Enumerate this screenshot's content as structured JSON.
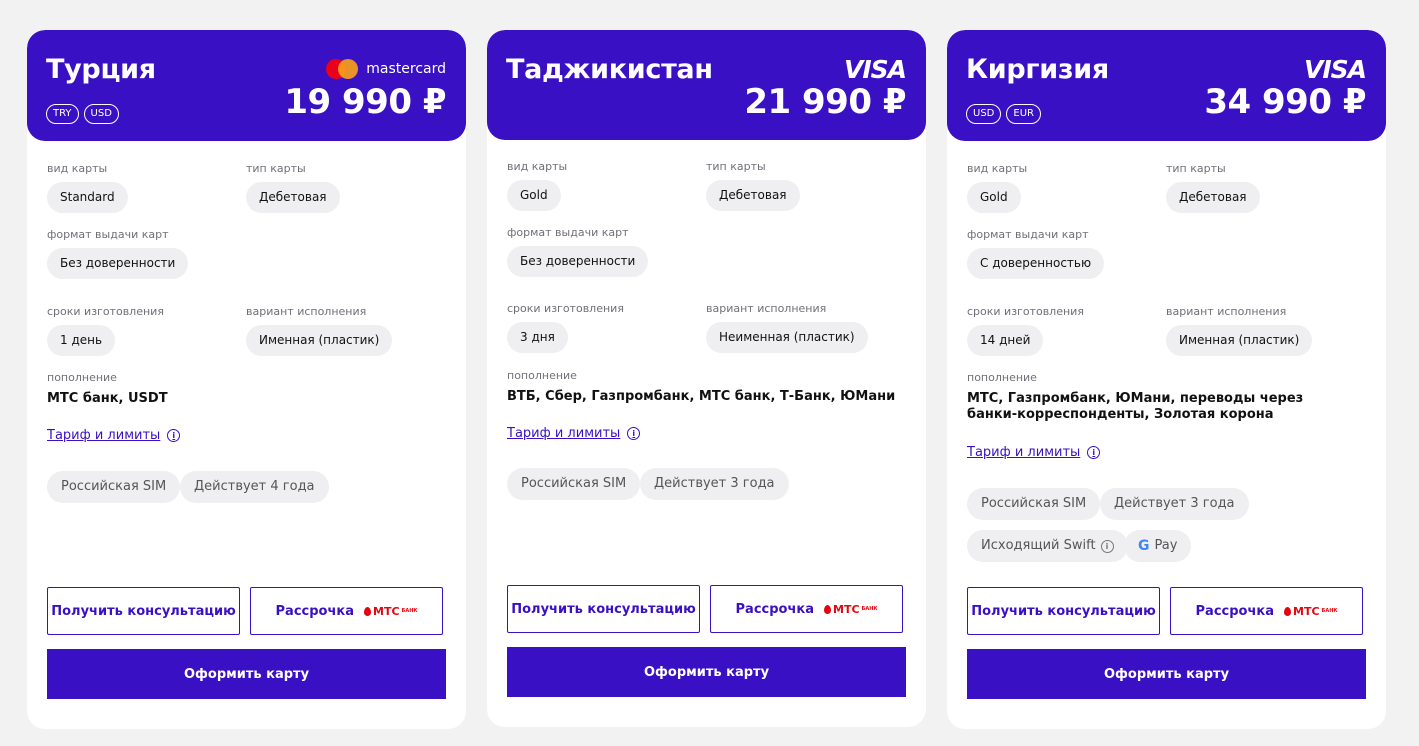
{
  "cards": [
    {
      "country": "Турция",
      "brand": "mastercard",
      "price": "19 990 ₽",
      "currencies": [
        "TRY",
        "USD"
      ],
      "card_type_label": "вид карты",
      "card_type": "Standard",
      "card_kind_label": "тип карты",
      "card_kind": "Дебетовая",
      "issue_format_label": "формат выдачи карт",
      "issue_format": "Без доверенности",
      "production_time_label": "сроки изготовления",
      "production_time": "1 день",
      "variant_label": "вариант исполнения",
      "variant": "Именная (пластик)",
      "topup_label": "пополнение",
      "topup": "МТС банк, USDT",
      "tariff": "Тариф и лимиты",
      "features": [
        "Российская SIM",
        "Действует 4 года"
      ],
      "consult_button": "Получить консультацию",
      "installment_button": "Рассрочка",
      "installment_partner": "МТС",
      "installment_partner_sub": "БАНК",
      "apply_button": "Оформить карту"
    },
    {
      "country": "Таджикистан",
      "brand": "VISA",
      "price": "21 990 ₽",
      "currencies": [],
      "card_type_label": "вид карты",
      "card_type": "Gold",
      "card_kind_label": "тип карты",
      "card_kind": "Дебетовая",
      "issue_format_label": "формат выдачи карт",
      "issue_format": "Без доверенности",
      "production_time_label": "сроки изготовления",
      "production_time": "3 дня",
      "variant_label": "вариант исполнения",
      "variant": "Неименная (пластик)",
      "topup_label": "пополнение",
      "topup": "ВТБ, Сбер, Газпромбанк, МТС банк, Т-Банк, ЮМани",
      "tariff": "Тариф и лимиты",
      "features": [
        "Российская SIM",
        "Действует 3 года"
      ],
      "consult_button": "Получить консультацию",
      "installment_button": "Рассрочка",
      "installment_partner": "МТС",
      "installment_partner_sub": "БАНК",
      "apply_button": "Оформить карту"
    },
    {
      "country": "Киргизия",
      "brand": "VISA",
      "price": "34 990 ₽",
      "currencies": [
        "USD",
        "EUR"
      ],
      "card_type_label": "вид карты",
      "card_type": "Gold",
      "card_kind_label": "тип карты",
      "card_kind": "Дебетовая",
      "issue_format_label": "формат выдачи карт",
      "issue_format": "С доверенностью",
      "production_time_label": "сроки изготовления",
      "production_time": "14 дней",
      "variant_label": "вариант исполнения",
      "variant": "Именная (пластик)",
      "topup_label": "пополнение",
      "topup": "МТС, Газпромбанк, ЮМани, переводы через банки-корреспонденты, Золотая корона",
      "tariff": "Тариф и лимиты",
      "features": [
        "Российская SIM",
        "Действует 3 года",
        "Исходящий Swift",
        "Pay"
      ],
      "consult_button": "Получить консультацию",
      "installment_button": "Рассрочка",
      "installment_partner": "МТС",
      "installment_partner_sub": "БАНК",
      "apply_button": "Оформить карту"
    }
  ],
  "colors": {
    "accent": "#3a10c4",
    "background": "#f2f2f3",
    "chip": "#efeff1",
    "mts_red": "#e30611"
  }
}
